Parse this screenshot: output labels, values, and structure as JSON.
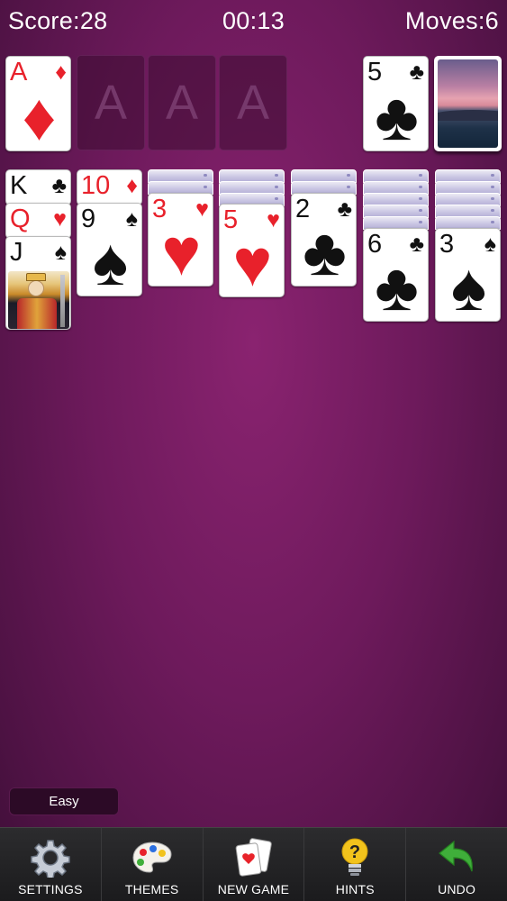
{
  "hud": {
    "score": "Score:28",
    "time": "00:13",
    "moves": "Moves:6"
  },
  "foundations": [
    {
      "rank": "A",
      "suit": "♦",
      "color": "red"
    },
    {
      "placeholder": "A"
    },
    {
      "placeholder": "A"
    },
    {
      "placeholder": "A"
    }
  ],
  "waste": {
    "rank": "5",
    "suit": "♣",
    "color": "black"
  },
  "tableau": [
    {
      "rank": "K",
      "suit": "♣"
    },
    {
      "rank": "Q",
      "suit": "♥"
    },
    {
      "rank": "J",
      "suit": "♠"
    },
    {
      "rank": "10",
      "suit": "♦"
    },
    {
      "rank": "9",
      "suit": "♠"
    },
    {
      "rank": "3",
      "suit": "♥"
    },
    {
      "rank": "5",
      "suit": "♥"
    },
    {
      "rank": "2",
      "suit": "♣"
    },
    {
      "rank": "6",
      "suit": "♣"
    },
    {
      "rank": "3",
      "suit": "♠"
    }
  ],
  "difficulty": "Easy",
  "toolbar": {
    "settings": "SETTINGS",
    "themes": "THEMES",
    "new_game": "NEW GAME",
    "hints": "HINTS",
    "undo": "UNDO"
  },
  "colors": {
    "red_suit": "#e8212b",
    "black_suit": "#111111",
    "felt": "#6e1a5c",
    "undo_arrow": "#3fae3a",
    "hint_bulb": "#f2c31c"
  }
}
